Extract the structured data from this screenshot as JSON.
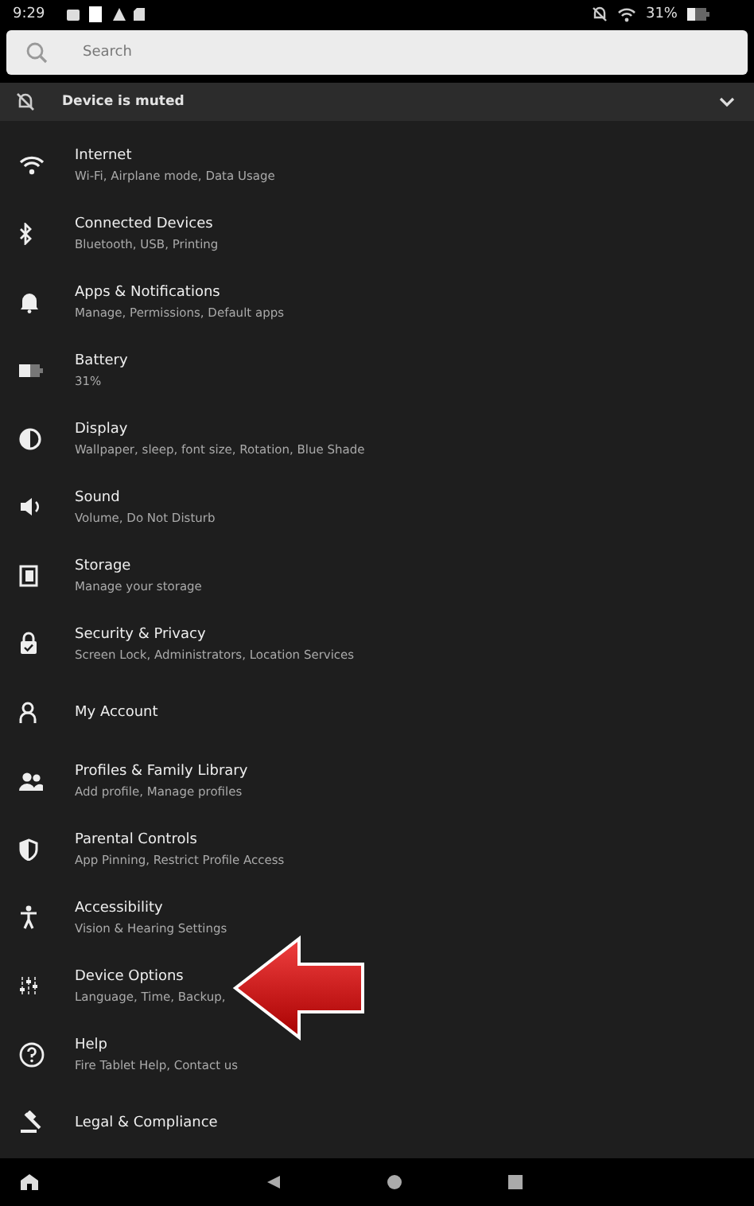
{
  "status_bar": {
    "time": "9:29",
    "battery": "31%"
  },
  "search": {
    "placeholder": "Search"
  },
  "banner": {
    "text": "Device is muted",
    "expanded": false
  },
  "items": [
    {
      "title": "Internet",
      "subtitle": "Wi-Fi, Airplane mode, Data Usage"
    },
    {
      "title": "Connected Devices",
      "subtitle": "Bluetooth, USB, Printing"
    },
    {
      "title": "Apps & Notifications",
      "subtitle": "Manage, Permissions, Default apps"
    },
    {
      "title": "Battery",
      "subtitle": "31%"
    },
    {
      "title": "Display",
      "subtitle": "Wallpaper, sleep, font size, Rotation, Blue Shade"
    },
    {
      "title": "Sound",
      "subtitle": "Volume, Do Not Disturb"
    },
    {
      "title": "Storage",
      "subtitle": "Manage your storage"
    },
    {
      "title": "Security & Privacy",
      "subtitle": "Screen Lock, Administrators, Location Services"
    },
    {
      "title": "My Account"
    },
    {
      "title": "Profiles & Family Library",
      "subtitle": "Add profile, Manage profiles"
    },
    {
      "title": "Parental Controls",
      "subtitle": "App Pinning, Restrict Profile Access"
    },
    {
      "title": "Accessibility",
      "subtitle": "Vision & Hearing Settings"
    },
    {
      "title": "Device Options",
      "subtitle": "Language, Time, Backup,",
      "pointed": true
    },
    {
      "title": "Help",
      "subtitle": "Fire Tablet Help, Contact us"
    },
    {
      "title": "Legal & Compliance"
    }
  ]
}
